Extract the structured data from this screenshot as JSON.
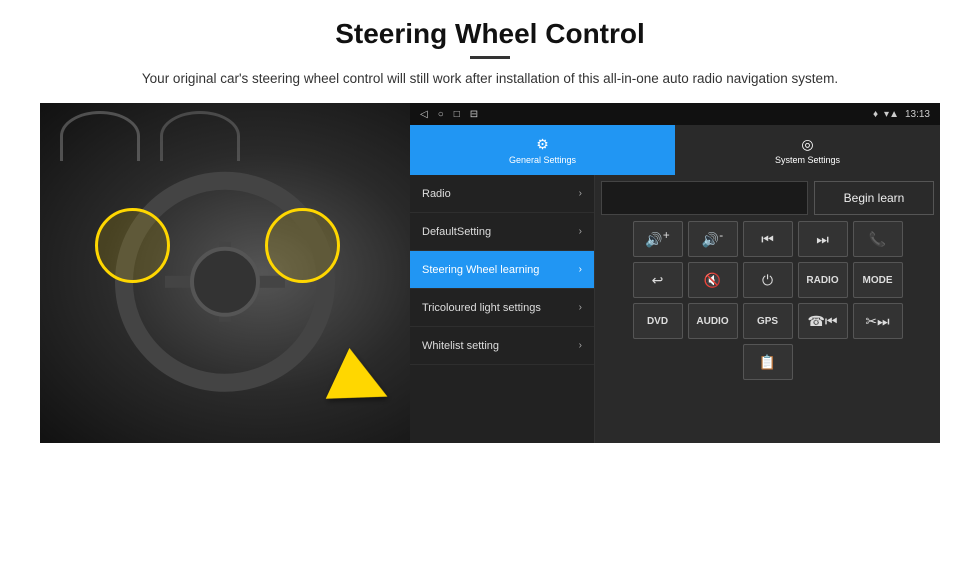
{
  "header": {
    "title": "Steering Wheel Control",
    "subtitle": "Your original car's steering wheel control will still work after installation of this all-in-one auto radio navigation system."
  },
  "status_bar": {
    "nav_icons": [
      "◁",
      "○",
      "□",
      "⊟"
    ],
    "location_icon": "♦",
    "wifi_icon": "▾",
    "time": "13:13"
  },
  "tabs": [
    {
      "label": "General Settings",
      "icon": "⚙",
      "active": true
    },
    {
      "label": "System Settings",
      "icon": "🔄",
      "active": false
    }
  ],
  "menu_items": [
    {
      "label": "Radio",
      "active": false
    },
    {
      "label": "DefaultSetting",
      "active": false
    },
    {
      "label": "Steering Wheel learning",
      "active": true
    },
    {
      "label": "Tricoloured light settings",
      "active": false
    },
    {
      "label": "Whitelist setting",
      "active": false
    }
  ],
  "begin_learn_label": "Begin learn",
  "controls": {
    "row1": [
      {
        "type": "icon",
        "value": "🔊+"
      },
      {
        "type": "icon",
        "value": "🔊-"
      },
      {
        "type": "icon",
        "value": "⏮"
      },
      {
        "type": "icon",
        "value": "⏭"
      },
      {
        "type": "icon",
        "value": "📞"
      }
    ],
    "row2": [
      {
        "type": "icon",
        "value": "↩"
      },
      {
        "type": "icon",
        "value": "🔇"
      },
      {
        "type": "icon",
        "value": "⏻"
      },
      {
        "type": "text",
        "value": "RADIO"
      },
      {
        "type": "text",
        "value": "MODE"
      }
    ],
    "row3": [
      {
        "type": "text",
        "value": "DVD"
      },
      {
        "type": "text",
        "value": "AUDIO"
      },
      {
        "type": "text",
        "value": "GPS"
      },
      {
        "type": "icon",
        "value": "📞⏮"
      },
      {
        "type": "icon",
        "value": "✂⏭"
      }
    ],
    "row4": [
      {
        "type": "icon",
        "value": "📋"
      }
    ]
  }
}
